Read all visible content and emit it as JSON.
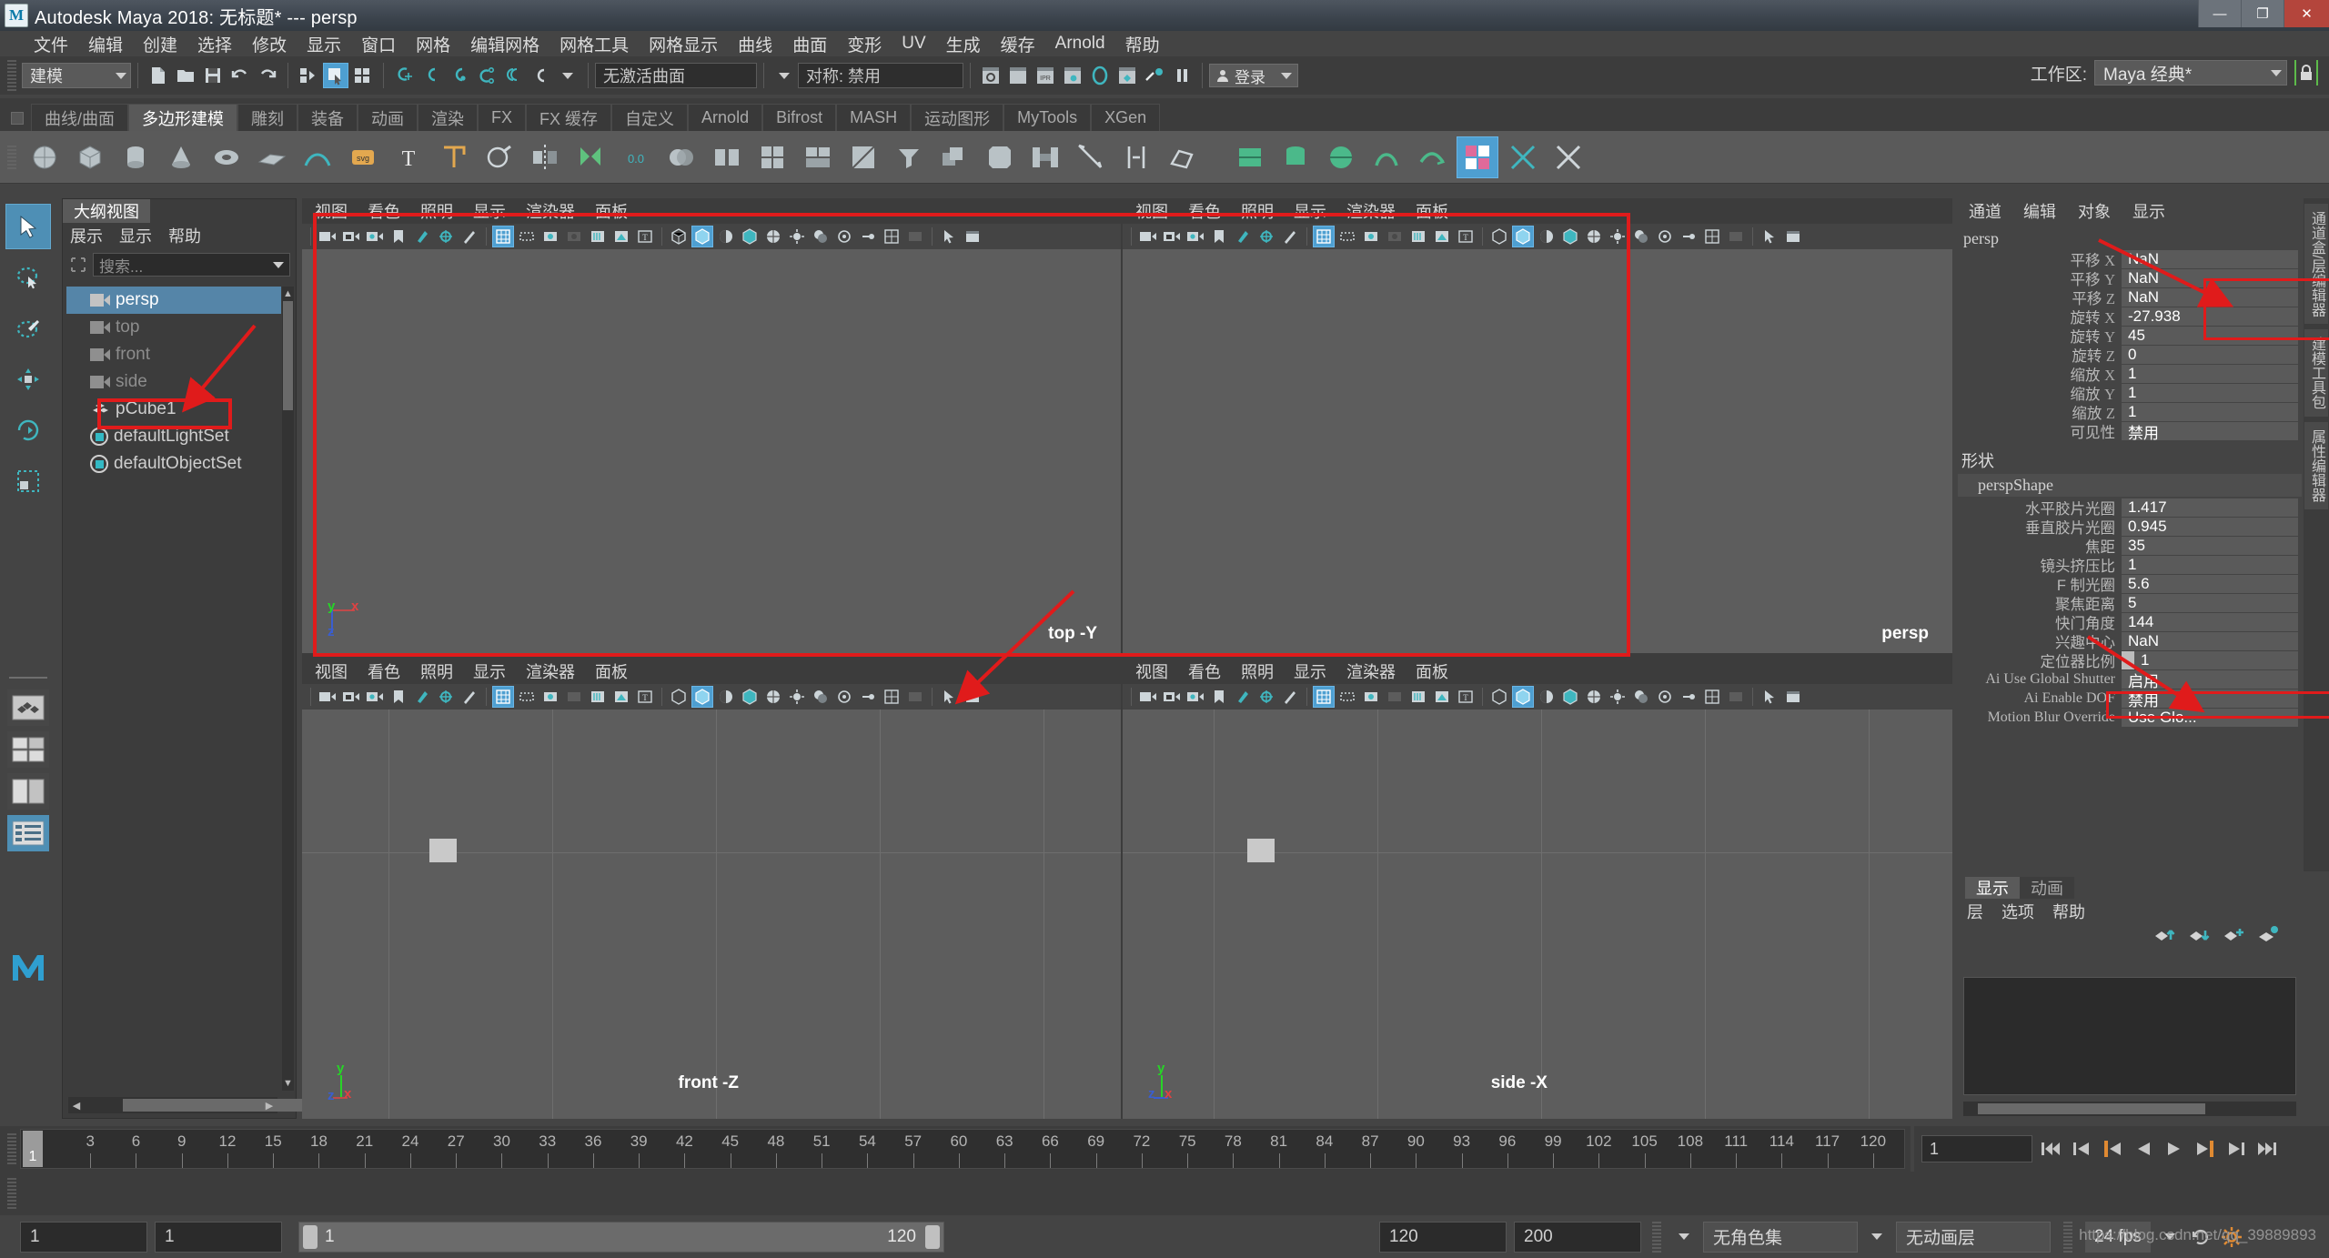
{
  "titlebar": {
    "title": "Autodesk Maya 2018: 无标题*   ---   persp",
    "logo": "M",
    "minimize": "—",
    "maximize": "❐",
    "close": "✕"
  },
  "menubar": {
    "items": [
      "文件",
      "编辑",
      "创建",
      "选择",
      "修改",
      "显示",
      "窗口",
      "网格",
      "编辑网格",
      "网格工具",
      "网格显示",
      "曲线",
      "曲面",
      "变形",
      "UV",
      "生成",
      "缓存",
      "Arnold",
      "帮助"
    ]
  },
  "statusline": {
    "menuset": "建模",
    "surface_field": "无激活曲面",
    "symmetry_field": "对称: 禁用",
    "login_label": "登录",
    "workspace_label": "工作区:",
    "workspace_value": "Maya 经典*"
  },
  "shelf": {
    "tabs": [
      "曲线/曲面",
      "多边形建模",
      "雕刻",
      "装备",
      "动画",
      "渲染",
      "FX",
      "FX 缓存",
      "自定义",
      "Arnold",
      "Bifrost",
      "MASH",
      "运动图形",
      "MyTools",
      "XGen"
    ],
    "active_tab": "多边形建模",
    "svg_label": "svg",
    "text_label": "T",
    "zero_label": "0.0"
  },
  "outliner": {
    "tab": "大纲视图",
    "menus": [
      "展示",
      "显示",
      "帮助"
    ],
    "search_placeholder": "搜索...",
    "items": [
      {
        "label": "persp",
        "icon": "camera-icon",
        "selected": true,
        "dim": false
      },
      {
        "label": "top",
        "icon": "camera-icon",
        "selected": false,
        "dim": true
      },
      {
        "label": "front",
        "icon": "camera-icon",
        "selected": false,
        "dim": true
      },
      {
        "label": "side",
        "icon": "camera-icon",
        "selected": false,
        "dim": true
      },
      {
        "label": "pCube1",
        "icon": "mesh-icon",
        "selected": false,
        "dim": false,
        "highlighted": true
      },
      {
        "label": "defaultLightSet",
        "icon": "set-icon",
        "selected": false,
        "dim": false
      },
      {
        "label": "defaultObjectSet",
        "icon": "set-icon",
        "selected": false,
        "dim": false
      }
    ]
  },
  "viewports": {
    "menus": [
      "视图",
      "看色",
      "照明",
      "显示",
      "渲染器",
      "面板"
    ],
    "panels": [
      {
        "label": "top -Y",
        "name": "top-viewport"
      },
      {
        "label": "persp",
        "name": "persp-viewport"
      },
      {
        "label": "front -Z",
        "name": "front-viewport"
      },
      {
        "label": "side -X",
        "name": "side-viewport"
      }
    ],
    "axis_labels": {
      "x": "x",
      "y": "y",
      "z": "z"
    }
  },
  "channelbox": {
    "menus": [
      "通道",
      "编辑",
      "对象",
      "显示"
    ],
    "object_name": "persp",
    "transform_rows": [
      {
        "label": "平移",
        "axis": "X",
        "value": "NaN",
        "flagged": true
      },
      {
        "label": "平移",
        "axis": "Y",
        "value": "NaN",
        "flagged": true
      },
      {
        "label": "平移",
        "axis": "Z",
        "value": "NaN",
        "flagged": true
      },
      {
        "label": "旋转",
        "axis": "X",
        "value": "-27.938",
        "flagged": false
      },
      {
        "label": "旋转",
        "axis": "Y",
        "value": "45",
        "flagged": false
      },
      {
        "label": "旋转",
        "axis": "Z",
        "value": "0",
        "flagged": false
      },
      {
        "label": "缩放",
        "axis": "X",
        "value": "1",
        "flagged": false
      },
      {
        "label": "缩放",
        "axis": "Y",
        "value": "1",
        "flagged": false
      },
      {
        "label": "缩放",
        "axis": "Z",
        "value": "1",
        "flagged": false
      },
      {
        "label": "可见性",
        "axis": "",
        "value": "禁用",
        "flagged": false
      }
    ],
    "shape_section_label": "形状",
    "shape_name": "perspShape",
    "shape_rows": [
      {
        "label": "水平胶片光圈",
        "value": "1.417",
        "mono": false
      },
      {
        "label": "垂直胶片光圈",
        "value": "0.945",
        "mono": false
      },
      {
        "label": "焦距",
        "value": "35",
        "mono": false
      },
      {
        "label": "镜头挤压比",
        "value": "1",
        "mono": false
      },
      {
        "label": "F 制光圈",
        "value": "5.6",
        "mono": false
      },
      {
        "label": "聚焦距离",
        "value": "5",
        "mono": false
      },
      {
        "label": "快门角度",
        "value": "144",
        "mono": false
      },
      {
        "label": "兴趣中心",
        "value": "NaN",
        "mono": false,
        "flagged": true
      },
      {
        "label": "定位器比例",
        "value": "1",
        "mono": false,
        "slider": true
      },
      {
        "label": "Ai Use Global Shutter",
        "value": "启用",
        "mono": true
      },
      {
        "label": "Ai Enable DOF",
        "value": "禁用",
        "mono": true
      },
      {
        "label": "Motion Blur Override",
        "value": "Use Glo...",
        "mono": true
      }
    ]
  },
  "right_tabs": [
    "通道盒/层编辑器",
    "建模工具包",
    "属性编辑器"
  ],
  "layer_editor": {
    "tabs": [
      "显示",
      "动画"
    ],
    "active_tab": "显示",
    "menus": [
      "层",
      "选项",
      "帮助"
    ],
    "buttons": [
      "layer-move-up-icon",
      "layer-move-down-icon",
      "layer-add-icon",
      "layer-new-icon"
    ]
  },
  "timeline": {
    "current_frame": "1",
    "tick_labels": [
      "3",
      "6",
      "9",
      "12",
      "15",
      "18",
      "21",
      "24",
      "27",
      "30",
      "33",
      "36",
      "39",
      "42",
      "45",
      "48",
      "51",
      "54",
      "57",
      "60",
      "63",
      "66",
      "69",
      "72",
      "75",
      "78",
      "81",
      "84",
      "87",
      "90",
      "93",
      "96",
      "99",
      "102",
      "105",
      "108",
      "111",
      "114",
      "117",
      "120"
    ],
    "playback_field": "1",
    "playback_buttons": [
      "go-to-start-icon",
      "step-back-key-icon",
      "step-back-frame-icon",
      "play-backward-icon",
      "play-forward-icon",
      "step-forward-frame-icon",
      "step-forward-key-icon",
      "go-to-end-icon"
    ]
  },
  "rangebar": {
    "anim_start": "1",
    "range_start": "1",
    "slider_start": "1",
    "slider_end": "120",
    "range_end": "120",
    "anim_end": "200",
    "character_set": "无角色集",
    "animation_layer": "无动画层",
    "fps": "24 fps"
  },
  "watermark": "https://blog.csdn.net/qq_39889893",
  "colors": {
    "accent_blue": "#4e9fd1",
    "selection_blue": "#5585a8",
    "annotation_red": "#e01b1b",
    "teal_icon": "#3fb6bf",
    "panel_bg": "#444444",
    "viewport_bg": "#5d5d5d",
    "dark_field": "#2b2b2b"
  }
}
